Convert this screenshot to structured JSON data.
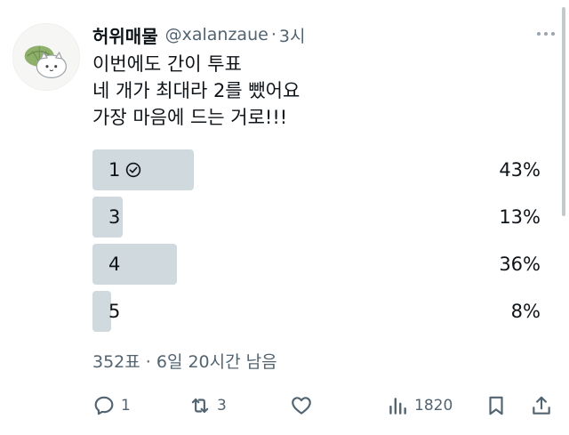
{
  "tweet": {
    "author_name": "허위매물",
    "handle": "@xalanzaue",
    "separator": "·",
    "time": "3시",
    "lines": [
      "이번에도 간이 투표",
      "네 개가 최대라 2를 뺐어요",
      "가장 마음에 드는 거로!!!"
    ]
  },
  "poll": {
    "options": [
      {
        "label": "1",
        "percent_text": "43%",
        "percent": 43,
        "selected": true
      },
      {
        "label": "3",
        "percent_text": "13%",
        "percent": 13,
        "selected": false
      },
      {
        "label": "4",
        "percent_text": "36%",
        "percent": 36,
        "selected": false
      },
      {
        "label": "5",
        "percent_text": "8%",
        "percent": 8,
        "selected": false
      }
    ],
    "meta": "352표 · 6일 20시간 남음"
  },
  "actions": {
    "reply_count": "1",
    "retweet_count": "3",
    "like_count": "",
    "views_count": "1820"
  },
  "icons": {
    "reply": "reply-icon",
    "retweet": "retweet-icon",
    "like": "heart-icon",
    "views": "views-icon",
    "bookmark": "bookmark-icon",
    "share": "share-icon",
    "more": "more-icon",
    "selected": "check-circle-icon"
  },
  "colors": {
    "bar": "#cfd9de",
    "muted": "#536471",
    "text": "#0f1419"
  }
}
